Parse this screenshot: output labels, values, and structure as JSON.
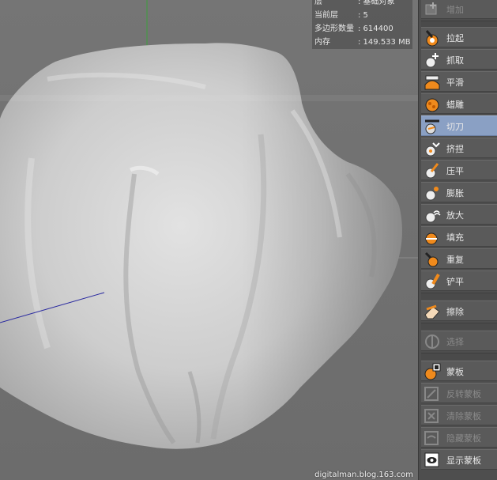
{
  "hud": {
    "rows": [
      {
        "key": "层",
        "value": ": 基础对象"
      },
      {
        "key": "当前层",
        "value": ": 5"
      },
      {
        "key": "多边形数量",
        "value": ": 614400"
      },
      {
        "key": "内存",
        "value": ": 149.533 MB"
      }
    ]
  },
  "panel": {
    "add_label": "增加",
    "tools": [
      {
        "label": "拉起",
        "icon": "pull-icon"
      },
      {
        "label": "抓取",
        "icon": "grab-icon"
      },
      {
        "label": "平滑",
        "icon": "smooth-icon"
      },
      {
        "label": "蜡雕",
        "icon": "wax-icon"
      },
      {
        "label": "切刀",
        "icon": "knife-icon",
        "active": true
      },
      {
        "label": "挤捏",
        "icon": "pinch-icon"
      },
      {
        "label": "压平",
        "icon": "flatten-icon"
      },
      {
        "label": "膨胀",
        "icon": "inflate-icon"
      },
      {
        "label": "放大",
        "icon": "amplify-icon"
      },
      {
        "label": "填充",
        "icon": "fill-icon"
      },
      {
        "label": "重复",
        "icon": "repeat-icon"
      },
      {
        "label": "铲平",
        "icon": "scrape-icon"
      }
    ],
    "erase_label": "擦除",
    "select_label": "选择",
    "mask_tools": [
      {
        "label": "蒙板",
        "icon": "mask-icon",
        "disabled": false
      },
      {
        "label": "反转蒙板",
        "icon": "invert-mask-icon",
        "disabled": true
      },
      {
        "label": "清除蒙板",
        "icon": "clear-mask-icon",
        "disabled": true
      },
      {
        "label": "隐藏蒙板",
        "icon": "hide-mask-icon",
        "disabled": true
      },
      {
        "label": "显示蒙板",
        "icon": "show-mask-icon",
        "disabled": false
      }
    ]
  },
  "watermark": "digitalman.blog.163.com",
  "colors": {
    "active_tool": "#8aa0c4",
    "panel": "#4e4e4e",
    "viewport": "#707070",
    "icon_orange": "#f08a1c"
  }
}
